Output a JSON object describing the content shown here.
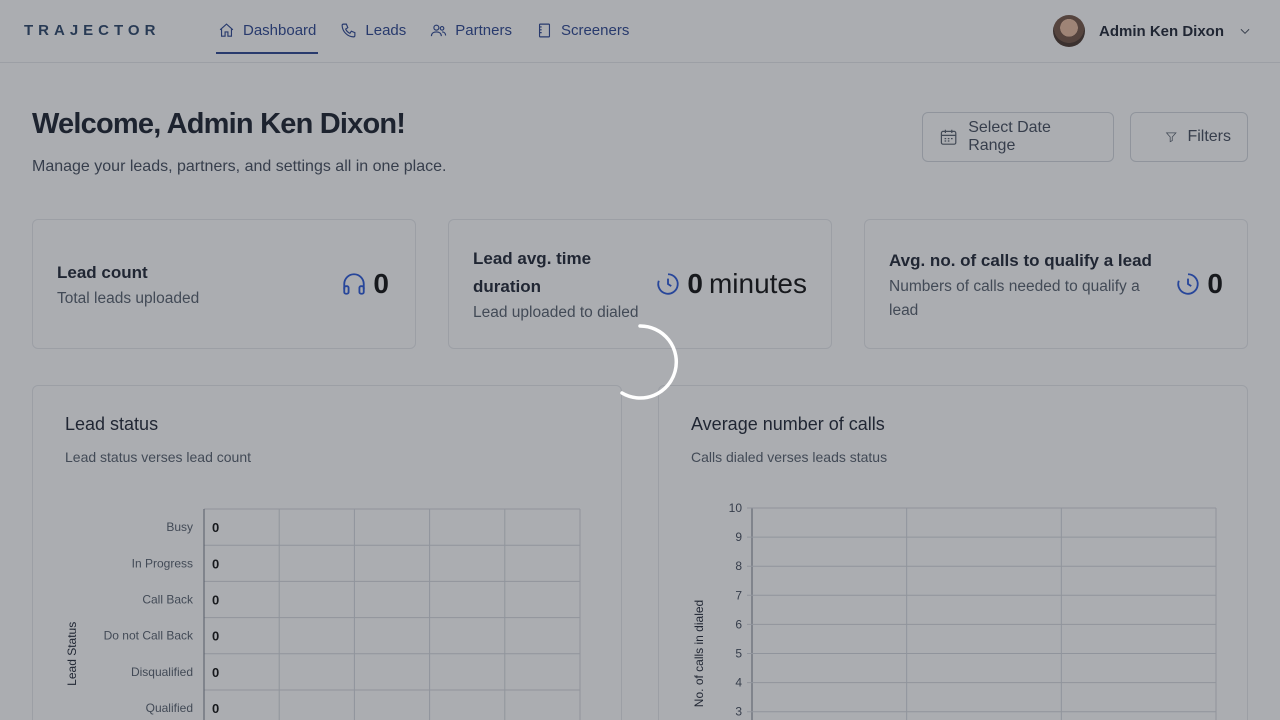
{
  "app": {
    "logo_text": "TRAJECTOR"
  },
  "nav": {
    "items": [
      {
        "label": "Dashboard",
        "icon": "home-icon",
        "active": true
      },
      {
        "label": "Leads",
        "icon": "phone-icon",
        "active": false
      },
      {
        "label": "Partners",
        "icon": "users-icon",
        "active": false
      },
      {
        "label": "Screeners",
        "icon": "document-icon",
        "active": false
      }
    ]
  },
  "user": {
    "name": "Admin Ken Dixon"
  },
  "page": {
    "welcome": "Welcome, Admin Ken Dixon!",
    "subtitle": "Manage your leads, partners, and settings all in one place.",
    "date_button": "Select Date Range",
    "filters_button": "Filters"
  },
  "stats": [
    {
      "title": "Lead count",
      "desc": "Total leads uploaded",
      "value": "0",
      "unit": "",
      "icon": "headphones-icon"
    },
    {
      "title_line1": "Lead avg. time",
      "title_line2": "duration",
      "desc": "Lead uploaded to dialed",
      "value": "0",
      "unit": "minutes",
      "icon": "timer-icon"
    },
    {
      "title": "Avg. no. of calls to qualify a lead",
      "desc_line1": "Numbers of calls needed to qualify a",
      "desc_line2": "lead",
      "value": "0",
      "unit": "",
      "icon": "timer-icon"
    }
  ],
  "panels": {
    "lead_status": {
      "title": "Lead status",
      "subtitle": "Lead status verses lead count"
    },
    "avg_calls": {
      "title": "Average number of calls",
      "subtitle": "Calls dialed verses leads status"
    }
  },
  "chart_data": [
    {
      "type": "bar",
      "orientation": "horizontal",
      "categories": [
        "Busy",
        "In Progress",
        "Call Back",
        "Do not Call Back",
        "Disqualified",
        "Qualified"
      ],
      "values": [
        0,
        0,
        0,
        0,
        0,
        0
      ],
      "ylabel": "Lead Status",
      "grid": true
    },
    {
      "type": "bar",
      "yticks": [
        3,
        4,
        5,
        6,
        7,
        8,
        9,
        10
      ],
      "ylim": [
        0,
        10
      ],
      "ylabel": "No. of calls in dialed",
      "grid": true
    }
  ],
  "colors": {
    "primary": "#1e3a8a",
    "icon_blue": "#1d4ed8",
    "overlay": "#373c46"
  }
}
